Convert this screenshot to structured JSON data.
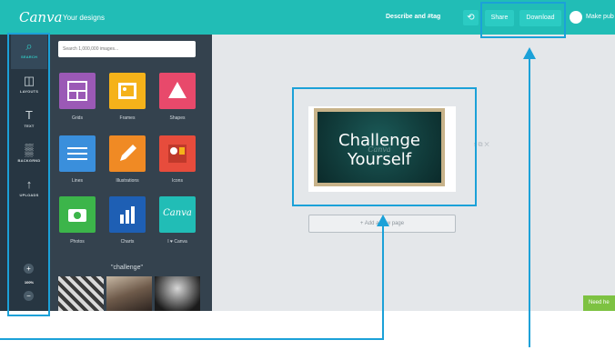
{
  "topbar": {
    "logo": "Canva",
    "your_designs": "Your designs",
    "doc_title": "Describe and #tag",
    "undo": "⟲",
    "share": "Share",
    "download": "Download",
    "make_public": "Make pub"
  },
  "rail": {
    "items": [
      {
        "icon": "search-icon",
        "glyph": "⌕",
        "label": "SEARCH"
      },
      {
        "icon": "layouts-icon",
        "glyph": "◫",
        "label": "LAYOUTS"
      },
      {
        "icon": "text-icon",
        "glyph": "T",
        "label": "TEXT"
      },
      {
        "icon": "background-icon",
        "glyph": "▒",
        "label": "BACKGRND"
      },
      {
        "icon": "upload-icon",
        "glyph": "↑",
        "label": "UPLOADS"
      }
    ],
    "zoom_in": "+",
    "zoom_out": "−",
    "zoom_level": "100%"
  },
  "panel": {
    "search_placeholder": "Search 1,000,000 images...",
    "tiles": [
      {
        "label": "Grids",
        "color": "#9b59b6"
      },
      {
        "label": "Frames",
        "color": "#f5b21a"
      },
      {
        "label": "Shapes",
        "color": "#e8496b"
      },
      {
        "label": "Lines",
        "color": "#3a8fdc"
      },
      {
        "label": "Illustrations",
        "color": "#f08a24"
      },
      {
        "label": "Icons",
        "color": "#e74c3c"
      },
      {
        "label": "Photos",
        "color": "#3cb54a"
      },
      {
        "label": "Charts",
        "color": "#1e5fb4"
      },
      {
        "label": "I ♥ Canva",
        "color": "#21bdb6"
      }
    ],
    "section_title": "\"challenge\""
  },
  "canvas": {
    "design_line1": "Challenge",
    "design_line2": "Yourself",
    "design_watermark": "Canva",
    "add_page": "+ Add a new page",
    "page_actions": "↑   ⧉   ✕",
    "need_help": "Need he"
  },
  "colors": {
    "brand": "#21bdb6",
    "callout": "#1ba1d8"
  }
}
